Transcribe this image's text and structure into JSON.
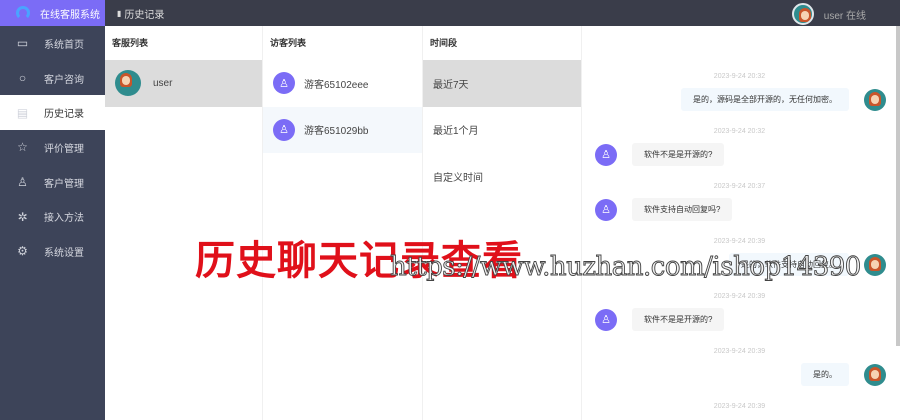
{
  "brand": "在线客服系统",
  "sidebar": {
    "items": [
      {
        "label": "系统首页",
        "icon": "▭"
      },
      {
        "label": "客户咨询",
        "icon": "○"
      },
      {
        "label": "历史记录",
        "icon": "▤"
      },
      {
        "label": "评价管理",
        "icon": "☆"
      },
      {
        "label": "客户管理",
        "icon": "♙"
      },
      {
        "label": "接入方法",
        "icon": "✲"
      },
      {
        "label": "系统设置",
        "icon": "⚙"
      }
    ]
  },
  "topbar": {
    "title": "历史记录",
    "user": "user 在线"
  },
  "agents": {
    "header": "客服列表",
    "items": [
      {
        "name": "user"
      }
    ]
  },
  "visitors": {
    "header": "访客列表",
    "items": [
      {
        "name": "游客65102eee"
      },
      {
        "name": "游客651029bb"
      }
    ]
  },
  "periods": {
    "header": "时间段",
    "items": [
      {
        "label": "最近7天"
      },
      {
        "label": "最近1个月"
      },
      {
        "label": "自定义时间"
      }
    ]
  },
  "chat": [
    {
      "time": "2023-9-24 20:32",
      "side": "right",
      "text": "是的，源码是全部开源的，无任何加密。"
    },
    {
      "time": "2023-9-24 20:32",
      "side": "left",
      "text": "软件不是是开源的?"
    },
    {
      "time": "2023-9-24 20:37",
      "side": "left",
      "text": "软件支持自动回复吗?"
    },
    {
      "time": "2023-9-24 20:39",
      "side": "right",
      "text": "是的，软件支持自动回复。"
    },
    {
      "time": "2023-9-24 20:39",
      "side": "left",
      "text": "软件不是是开源的?"
    },
    {
      "time": "2023-9-24 20:39",
      "side": "right",
      "text": "是的。"
    },
    {
      "time": "2023-9-24 20:39",
      "side": "right",
      "text": ""
    }
  ],
  "overlay": {
    "caption": "历史聊天记录查看",
    "watermark": "https://www.huzhan.com/ishop14390"
  },
  "colors": {
    "accent": "#7b6cf6",
    "sidebar": "#3d4459",
    "caption": "#e0101a"
  }
}
